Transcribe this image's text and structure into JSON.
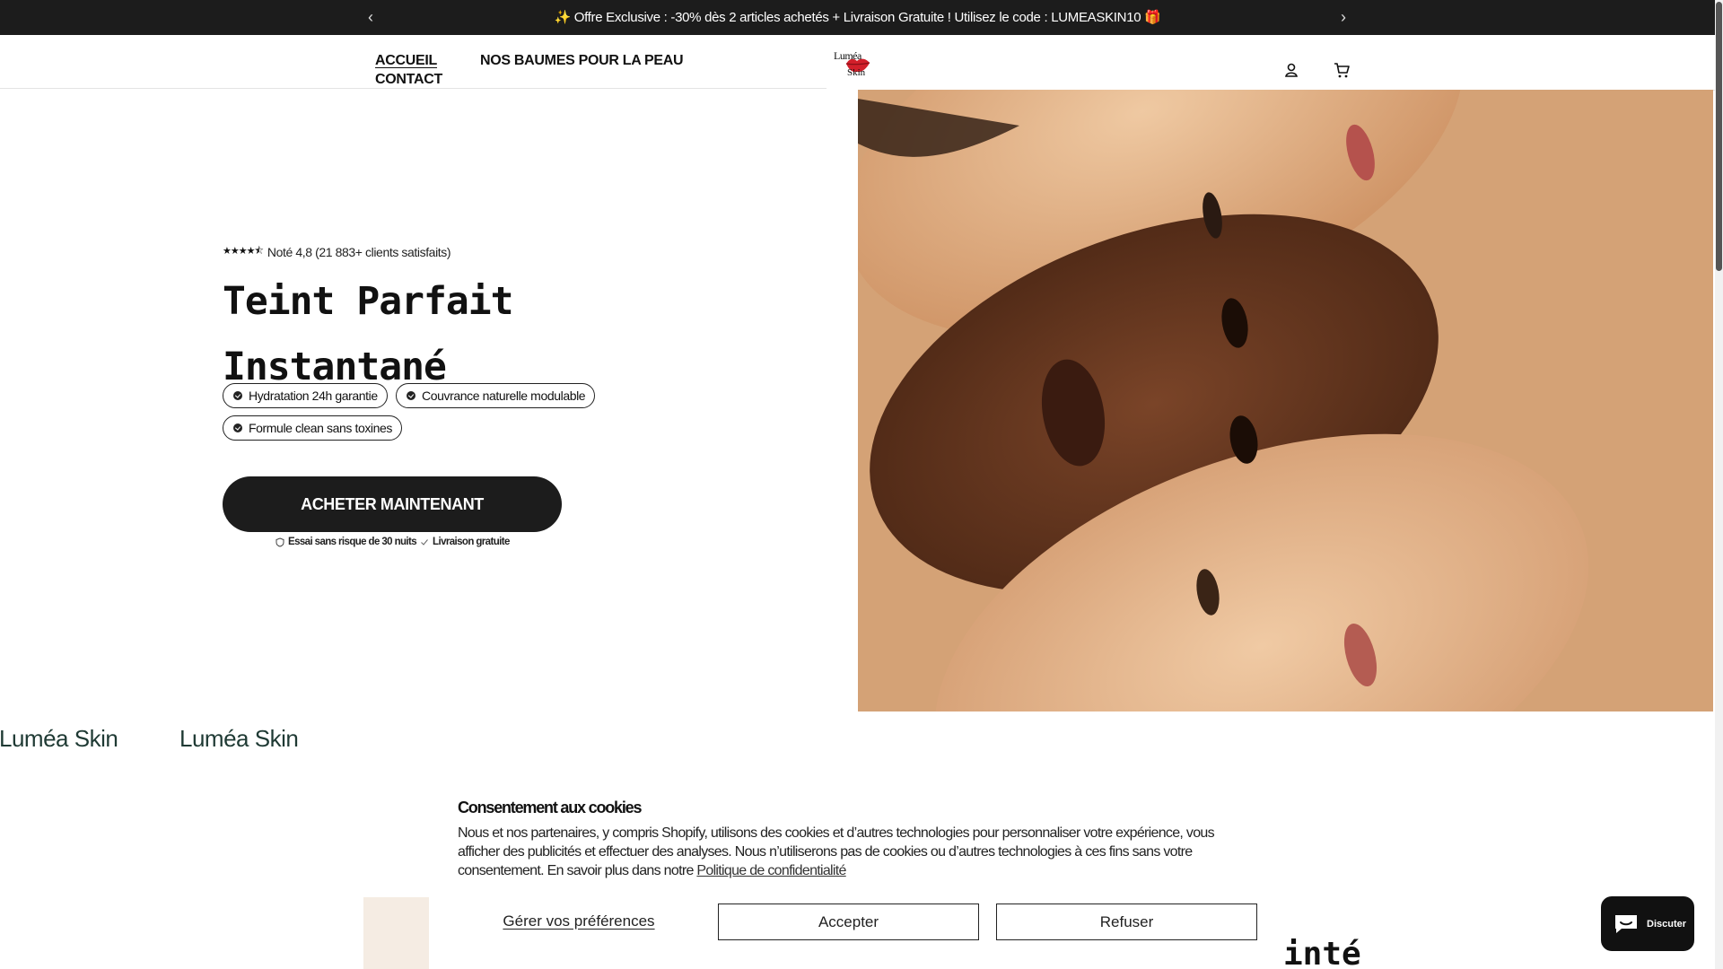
{
  "announcement": {
    "text": "✨ Offre Exclusive : -30% dès 2 articles achetés + Livraison Gratuite ! Utilisez le code : LUMEASKIN10 🎁",
    "prev_icon": "‹",
    "next_icon": "›"
  },
  "header": {
    "nav": [
      {
        "label": "ACCUEIL",
        "active": true
      },
      {
        "label": "NOS BAUMES POUR LA PEAU",
        "active": false
      },
      {
        "label": "CONTACT",
        "active": false
      }
    ],
    "logo_text": [
      "Luméa",
      "Skin"
    ],
    "icons": [
      "account-icon",
      "cart-icon"
    ]
  },
  "hero": {
    "rating_text": "Noté 4,8 (21 883+ clients satisfaits)",
    "stars": "★★★★⯪",
    "headline_line1": "Teint Parfait",
    "headline_line2": "Instantané",
    "badges": [
      "Hydratation 24h garantie",
      "Couvrance naturelle modulable",
      "Formule clean sans toxines"
    ],
    "cta_label": "ACHETER MAINTENANT",
    "guarantee_1": "Essai sans risque de 30 nuits",
    "guarantee_2": "Livraison gratuite"
  },
  "marquee": [
    "Luméa Skin",
    "Luméa Skin"
  ],
  "partial_heading": "inté",
  "cookie": {
    "title": "Consentement aux cookies",
    "body": "Nous et nos partenaires, y compris Shopify, utilisons des cookies et d’autres technologies pour personnaliser votre expérience, vous afficher des publicités et effectuer des analyses. Nous n’utiliserons pas de cookies ou d’autres technologies à ces fins sans votre consentement. En savoir plus dans notre",
    "policy_link": "Politique de confidentialité",
    "manage_label": "Gérer vos préférences",
    "accept_label": "Accepter",
    "refuse_label": "Refuser"
  },
  "chat": {
    "label": "Discuter"
  },
  "colors": {
    "announcement_bg": "#1c1c1c",
    "cta_bg": "#1c1c1c",
    "marquee_text": "#1f3a34"
  }
}
